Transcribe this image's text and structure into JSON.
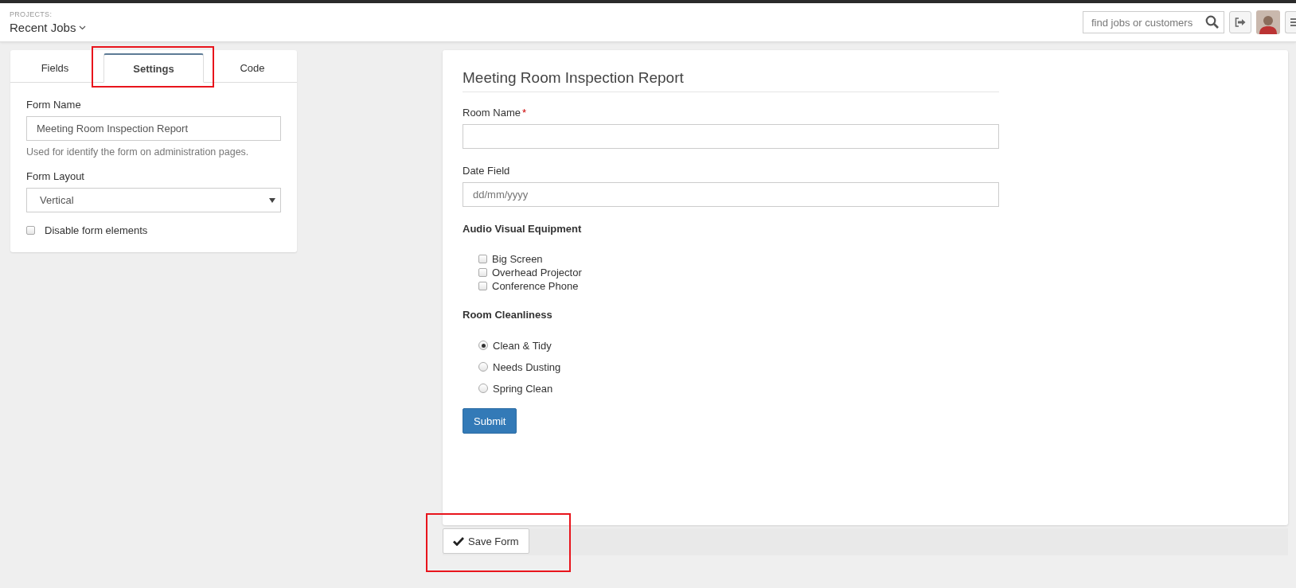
{
  "header": {
    "projects_label": "PROJECTS:",
    "project": "Recent Jobs",
    "search_placeholder": "find jobs or customers"
  },
  "tabs": [
    {
      "label": "Fields",
      "selected": false,
      "highlighted": false
    },
    {
      "label": "Settings",
      "selected": true,
      "highlighted": true
    },
    {
      "label": "Code",
      "selected": false,
      "highlighted": false
    }
  ],
  "settings": {
    "form_name": {
      "label": "Form Name",
      "value": "Meeting Room Inspection Report",
      "help": "Used for identify the form on administration pages."
    },
    "form_layout": {
      "label": "Form Layout",
      "value": "Vertical"
    },
    "disable_elements": {
      "label": "Disable form elements",
      "checked": false
    }
  },
  "preview": {
    "title": "Meeting Room Inspection Report",
    "fields": [
      {
        "kind": "text",
        "label": "Room Name",
        "required": true,
        "required_mark": "*"
      },
      {
        "kind": "date",
        "label": "Date Field",
        "placeholder": "dd/mm/yyyy"
      },
      {
        "kind": "checkboxes",
        "label": "Audio Visual Equipment",
        "options": [
          {
            "label": "Big Screen",
            "checked": false
          },
          {
            "label": "Overhead Projector",
            "checked": false
          },
          {
            "label": "Conference Phone",
            "checked": false
          }
        ]
      },
      {
        "kind": "radios",
        "label": "Room Cleanliness",
        "options": [
          {
            "label": "Clean & Tidy",
            "selected": true
          },
          {
            "label": "Needs Dusting",
            "selected": false
          },
          {
            "label": "Spring Clean",
            "selected": false
          }
        ]
      }
    ],
    "submit": "Submit"
  },
  "save_button": {
    "label": "Save Form",
    "highlighted": true
  }
}
